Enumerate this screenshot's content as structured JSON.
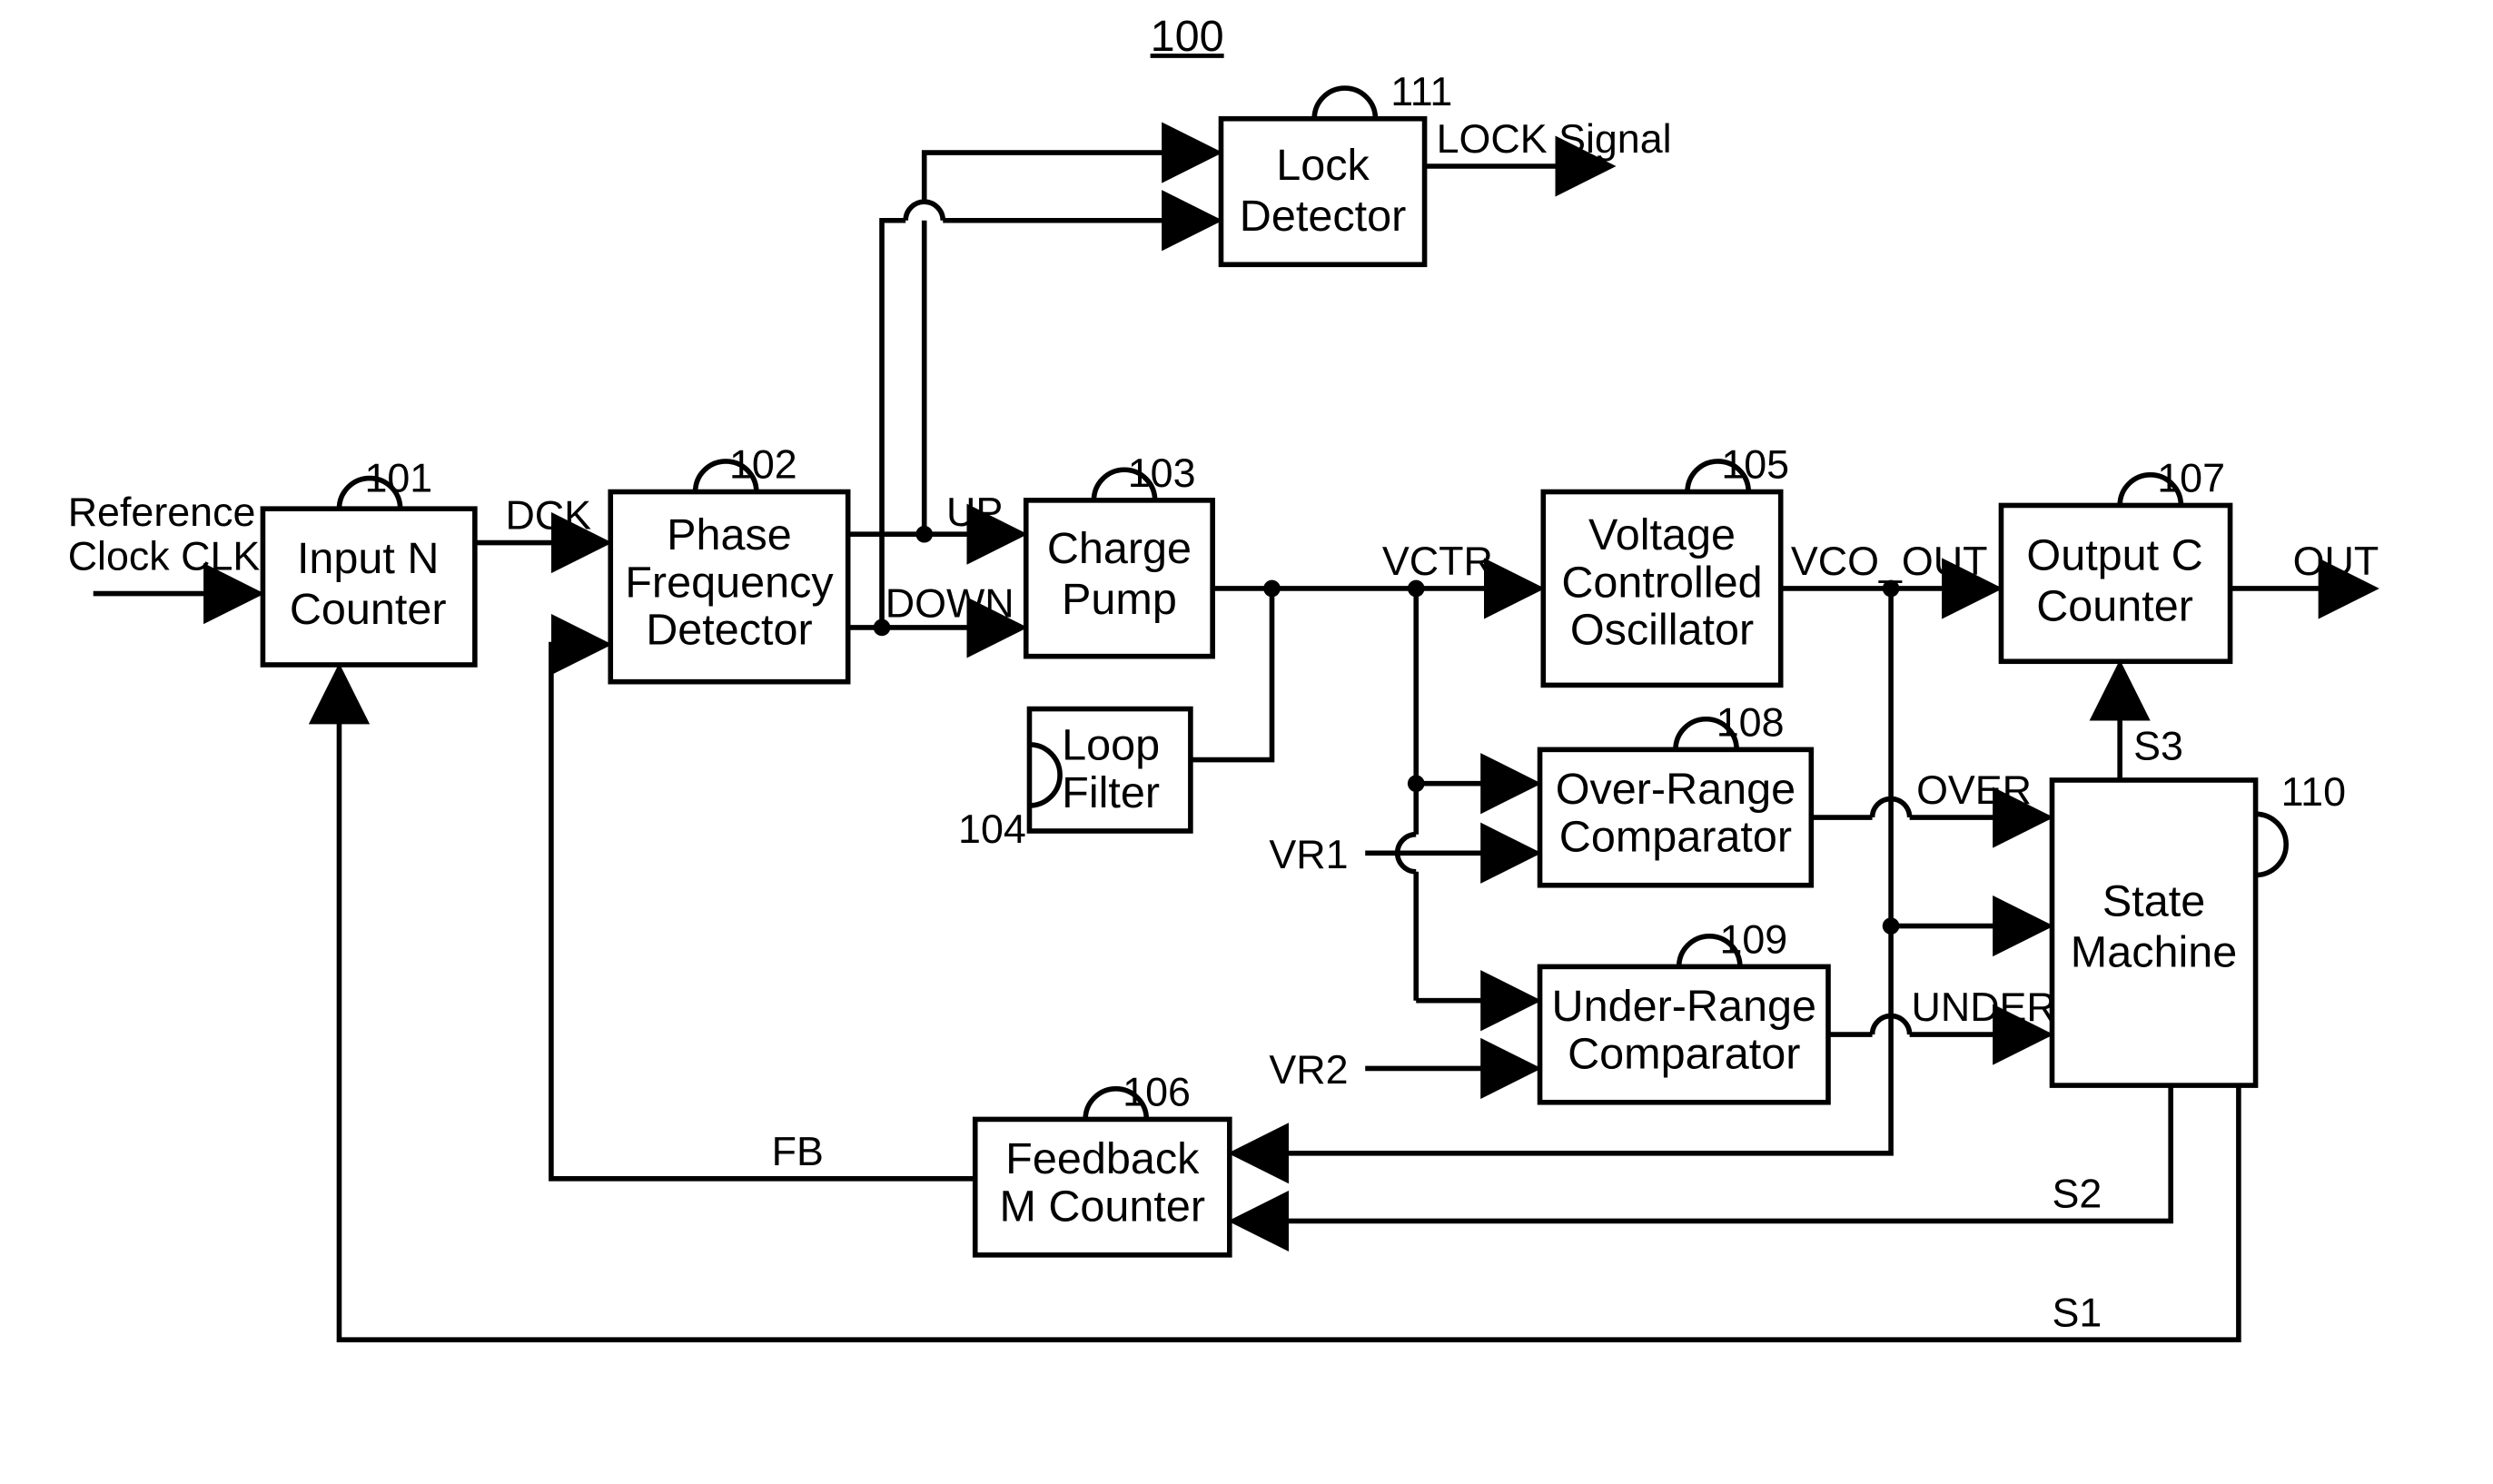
{
  "figure_ref": "100",
  "blocks": {
    "b101": {
      "ref": "101",
      "lines": [
        "Input N",
        "Counter"
      ]
    },
    "b102": {
      "ref": "102",
      "lines": [
        "Phase",
        "Frequency",
        "Detector"
      ]
    },
    "b103": {
      "ref": "103",
      "lines": [
        "Charge",
        "Pump"
      ]
    },
    "b104": {
      "ref": "104",
      "lines": [
        "Loop",
        "Filter"
      ]
    },
    "b105": {
      "ref": "105",
      "lines": [
        "Voltage",
        "Controlled",
        "Oscillator"
      ]
    },
    "b106": {
      "ref": "106",
      "lines": [
        "Feedback",
        "M Counter"
      ]
    },
    "b107": {
      "ref": "107",
      "lines": [
        "Output C",
        "Counter"
      ]
    },
    "b108": {
      "ref": "108",
      "lines": [
        "Over-Range",
        "Comparator"
      ]
    },
    "b109": {
      "ref": "109",
      "lines": [
        "Under-Range",
        "Comparator"
      ]
    },
    "b110": {
      "ref": "110",
      "lines": [
        "State",
        "Machine"
      ]
    },
    "b111": {
      "ref": "111",
      "lines": [
        "Lock",
        "Detector"
      ]
    }
  },
  "signals": {
    "ref_clk_l1": "Reference",
    "ref_clk_l2": "Clock CLK",
    "dck": "DCK",
    "up": "UP",
    "down": "DOWN",
    "vctr": "VCTR",
    "vco_out": "VCO_OUT",
    "out": "OUT",
    "lock": "LOCK Signal",
    "vr1": "VR1",
    "vr2": "VR2",
    "over": "OVER",
    "under": "UNDER",
    "fb": "FB",
    "s1": "S1",
    "s2": "S2",
    "s3": "S3"
  }
}
